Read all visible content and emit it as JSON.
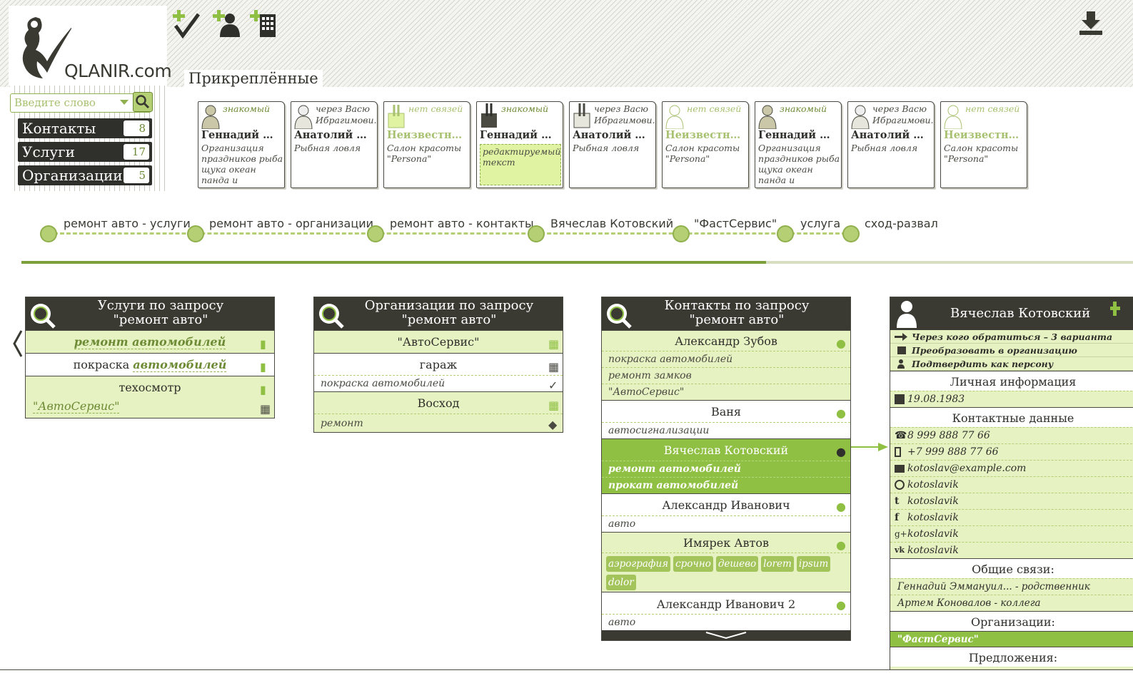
{
  "brand": {
    "logo_text": "QLANIR.com"
  },
  "header": {
    "pinned_title": "Прикреплённые",
    "icons": [
      "add-task-icon",
      "add-person-icon",
      "add-organization-icon",
      "download-icon"
    ]
  },
  "search": {
    "placeholder": "Введите слово"
  },
  "nav": [
    {
      "label": "Контакты",
      "count": "8"
    },
    {
      "label": "Услуги",
      "count": "17"
    },
    {
      "label": "Организации",
      "count": "5"
    }
  ],
  "pinned_cards": [
    {
      "relation": "знакомый",
      "name": "Геннадий Пет...",
      "desc": "Организация праздников рыба щука океан панда и продолжение",
      "kind": "person"
    },
    {
      "relation": "через Васю Ибрагимови...",
      "name": "Анатолий Ива...",
      "desc": "Рыбная ловля",
      "kind": "person-hatched"
    },
    {
      "relation": "нет связей",
      "name": "Неизвестный",
      "desc": "Салон красоты \"Persona\"",
      "kind": "unknown-org"
    },
    {
      "relation": "знакомый",
      "name": "Геннадий Пет...",
      "edit": "редактируемый текст",
      "kind": "org-dark"
    },
    {
      "relation": "через Васю Ибрагимови...",
      "name": "Анатолий Ива...",
      "desc": "Рыбная ловля",
      "kind": "org-hatched"
    },
    {
      "relation": "нет связей",
      "name": "Неизвестный",
      "desc": "Салон красоты \"Persona\"",
      "kind": "unknown-person"
    },
    {
      "relation": "знакомый",
      "name": "Геннадий Пет...",
      "desc": "Организация праздников рыба щука океан панда и продолжение",
      "kind": "person"
    },
    {
      "relation": "через Васю Ибрагимови...",
      "name": "Анатолий Ива...",
      "desc": "Рыбная ловля",
      "kind": "person-hatched"
    },
    {
      "relation": "нет связей",
      "name": "Неизвестный",
      "desc": "Салон красоты \"Persona\"",
      "kind": "unknown-person"
    }
  ],
  "trail": [
    {
      "label": "ремонт авто - услуги",
      "icon": "search-icon"
    },
    {
      "label": "ремонт авто - организации",
      "icon": "search-icon"
    },
    {
      "label": "ремонт авто - контакты",
      "icon": "search-icon"
    },
    {
      "label": "Вячеслав Котовский",
      "icon": "person-icon"
    },
    {
      "label": "\"ФастСервис\"",
      "icon": "organization-icon"
    },
    {
      "label": "услуга",
      "icon": "service-icon"
    },
    {
      "label": "сход-развал",
      "icon": "check-icon"
    }
  ],
  "progress": 0.67,
  "services_panel": {
    "title_line1": "Услуги по запросу",
    "title_line2": "\"ремонт авто\"",
    "row1": "ремонт автомобилей",
    "row2_prefix": "покраска",
    "row2_word": "автомобилей",
    "row3": "техосмотр",
    "row3_sub": "\"АвтоСервис\""
  },
  "orgs_panel": {
    "title_line1": "Организации по запросу",
    "title_line2": "\"ремонт авто\"",
    "row1": "\"АвтоСервис\"",
    "row2": "гараж",
    "row2_sub": "покраска автомобилей",
    "row3": "Восход",
    "row3_sub": "ремонт"
  },
  "contacts_panel": {
    "title_line1": "Контакты по запросу",
    "title_line2": "\"ремонт авто\"",
    "c1": "Александр Зубов",
    "c1_s1": "покраска автомобилей",
    "c1_s2": "ремонт замков",
    "c1_s3": "\"АвтоСервис\"",
    "c2": "Ваня",
    "c2_s1": "автосигнализации",
    "c3": "Вячеслав Котовский",
    "c3_s1": "ремонт автомобилей",
    "c3_s2": "прокат автомобилей",
    "c4": "Александр Иванович",
    "c4_s1": "авто",
    "c5": "Имярек Автов",
    "c5_tags": [
      "аэрография",
      "срочно",
      "дешево",
      "lorem",
      "ipsum",
      "dolor"
    ],
    "c6": "Александр Иванович 2",
    "c6_s1": "авто"
  },
  "profile": {
    "name": "Вячеслав Котовский",
    "action1": "Через кого обратиться – 3 варианта",
    "action2": "Преобразовать в организацию",
    "action3": "Подтвердить как персону",
    "personal_title": "Личная информация",
    "birthday": "19.08.1983",
    "contacts_title": "Контактные данные",
    "phone": "8 999 888 77 66",
    "mobile": "+7 999 888 77 66",
    "email": "kotoslav@example.com",
    "skype": "kotoslavik",
    "twitter": "kotoslavik",
    "facebook": "kotoslavik",
    "gplus": "kotoslavik",
    "vk": "kotoslavik",
    "common_title": "Общие связи:",
    "rel1": "Геннадий Эммануил...  - родственник",
    "rel2": "Артем Коновалов - коллега",
    "orgs_title": "Организации:",
    "org1": "\"ФастСервис\"",
    "offers_title": "Предложения:"
  },
  "colors": {
    "dark": "#3a3a33",
    "lime": "#8fc043",
    "pale": "#e6f2c2",
    "olive": "#6d8a34"
  }
}
